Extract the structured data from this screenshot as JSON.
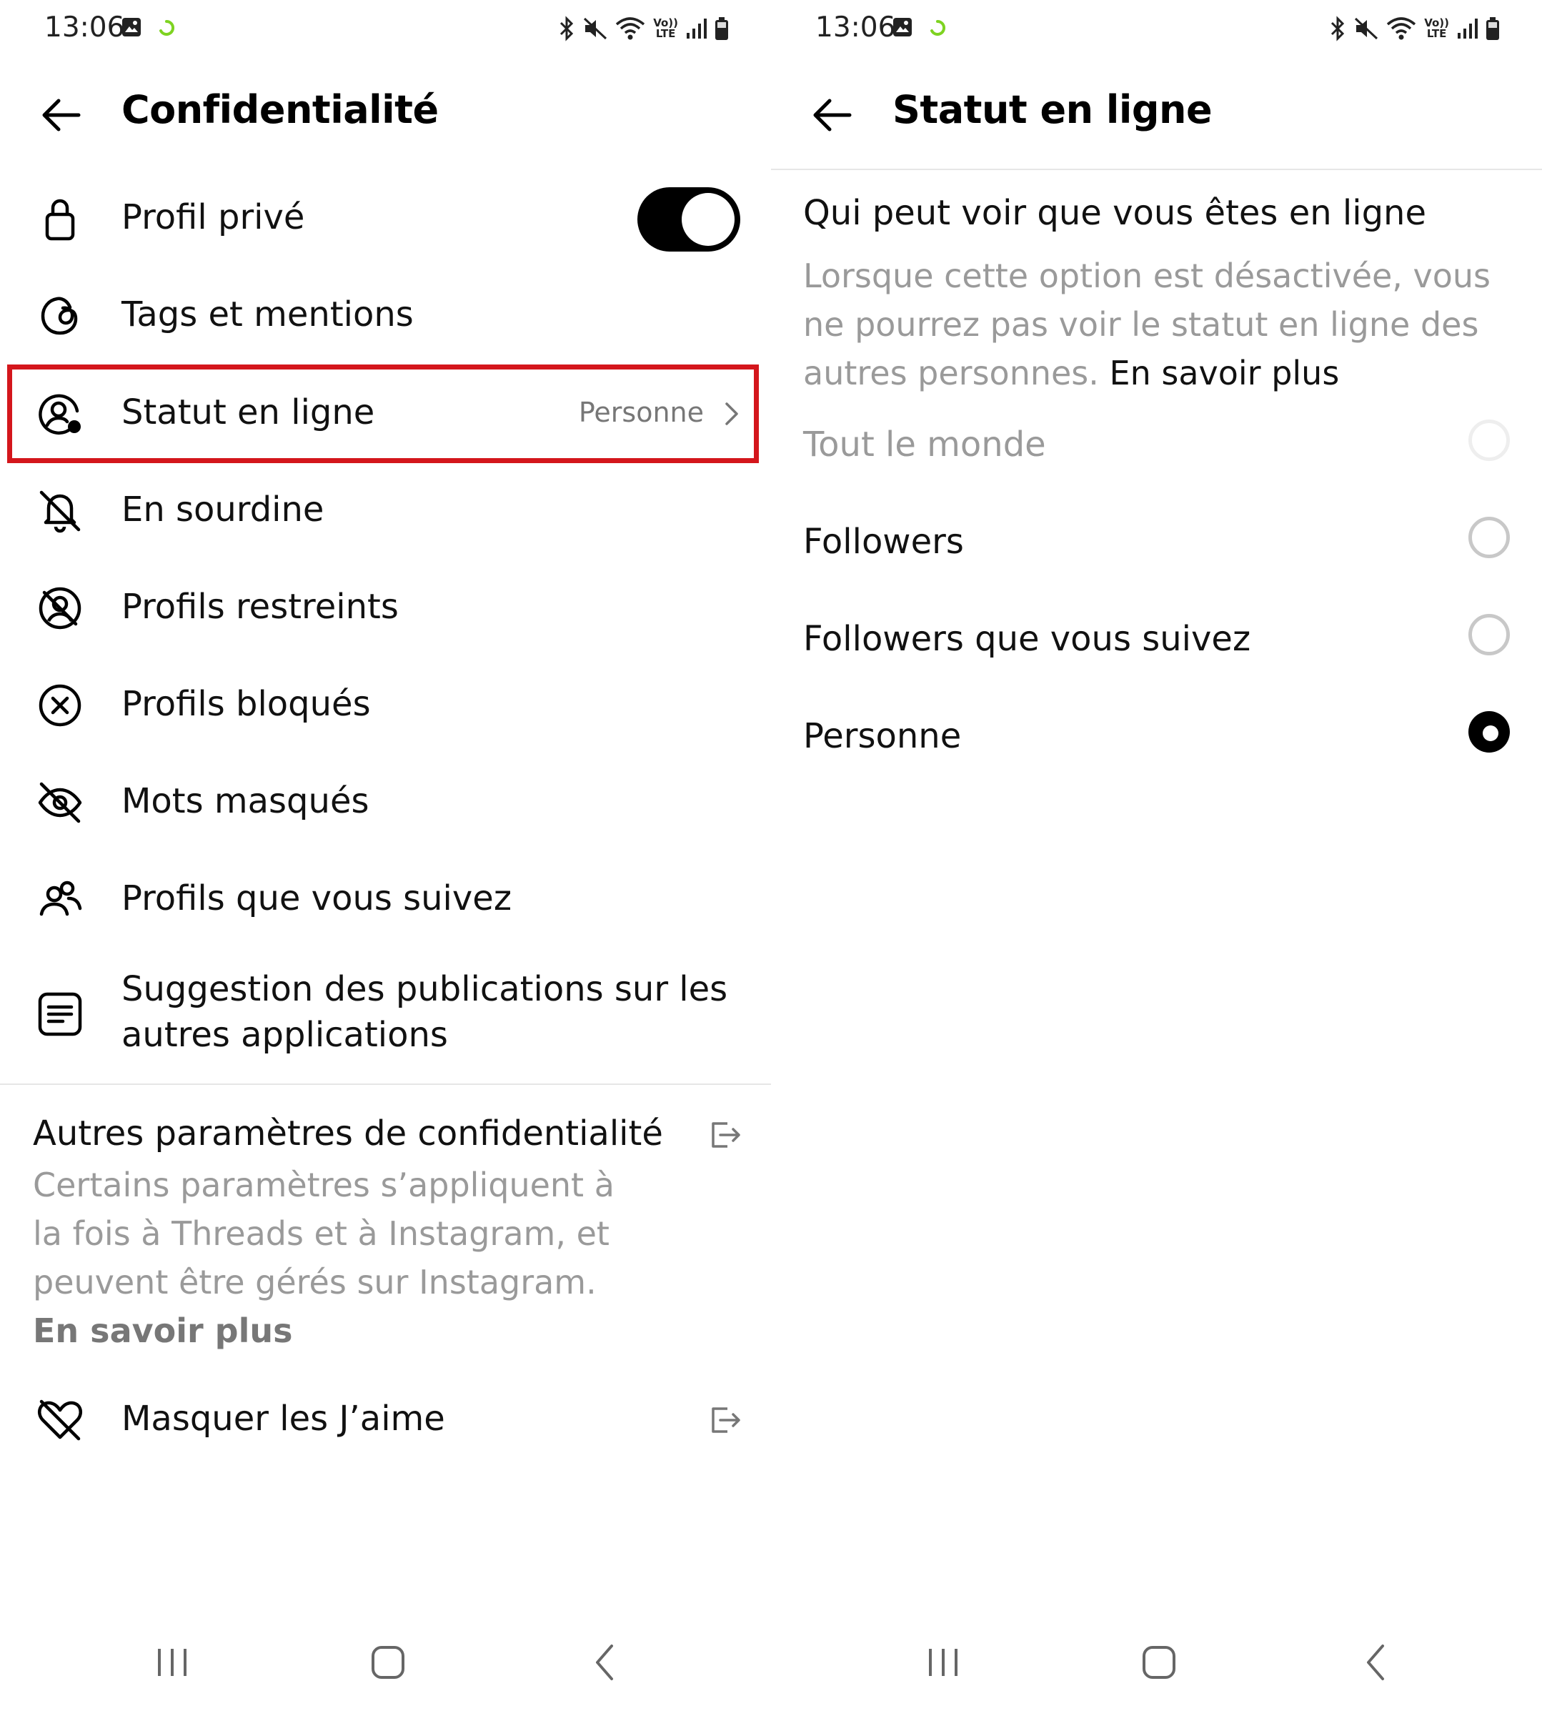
{
  "colors": {
    "highlight": "#d4161c",
    "secondary_text": "#9a9a9a",
    "toggle_on": "#000000"
  },
  "left": {
    "status_bar": {
      "time": "13:06"
    },
    "title": "Confidentialité",
    "items": [
      {
        "label": "Profil privé",
        "icon": "lock-icon",
        "toggle_on": true
      },
      {
        "label": "Tags et mentions",
        "icon": "threads-at-icon"
      },
      {
        "label": "Statut en ligne",
        "icon": "online-status-icon",
        "value": "Personne",
        "highlighted": true
      },
      {
        "label": "En sourdine",
        "icon": "bell-off-icon"
      },
      {
        "label": "Profils restreints",
        "icon": "restricted-profile-icon"
      },
      {
        "label": "Profils bloqués",
        "icon": "blocked-icon"
      },
      {
        "label": "Mots masqués",
        "icon": "eye-off-icon"
      },
      {
        "label": "Profils que vous suivez",
        "icon": "people-icon"
      },
      {
        "label_line1": "Suggestion des publications sur les",
        "label_line2": "autres applications",
        "icon": "document-icon"
      }
    ],
    "other_section": {
      "title": "Autres paramètres de confidentialité",
      "description": "Certains paramètres s’appliquent à la fois à Threads et à Instagram, et peuvent être gérés sur Instagram.",
      "link": "En savoir plus"
    },
    "hide_likes": {
      "label": "Masquer les J’aime",
      "icon": "heart-off-icon"
    }
  },
  "right": {
    "status_bar": {
      "time": "13:06"
    },
    "title": "Statut en ligne",
    "subtitle": "Qui peut voir que vous êtes en ligne",
    "description": "Lorsque cette option est désactivée, vous ne pourrez pas voir le statut en ligne des autres personnes.",
    "link": "En savoir plus",
    "options": [
      {
        "label": "Tout le monde",
        "selected": false,
        "disabled": true
      },
      {
        "label": "Followers",
        "selected": false,
        "disabled": false
      },
      {
        "label": "Followers que vous suivez",
        "selected": false,
        "disabled": false
      },
      {
        "label": "Personne",
        "selected": true,
        "disabled": false
      }
    ]
  }
}
